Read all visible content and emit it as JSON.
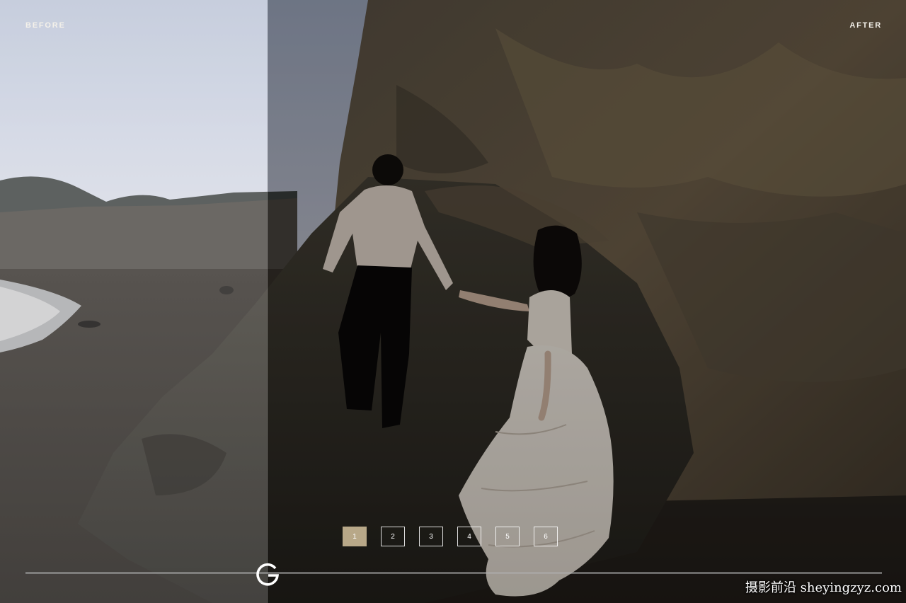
{
  "labels": {
    "before": "BEFORE",
    "after": "AFTER"
  },
  "pagination": {
    "pages": [
      "1",
      "2",
      "3",
      "4",
      "5",
      "6"
    ],
    "active": "1"
  },
  "slider": {
    "handle_icon": "g-logo-icon",
    "position_fraction": 0.295
  },
  "watermark": "摄影前沿 sheyingzyz.com",
  "colors": {
    "active_page": "#b8a888",
    "label_text": "#f4f1ea"
  }
}
